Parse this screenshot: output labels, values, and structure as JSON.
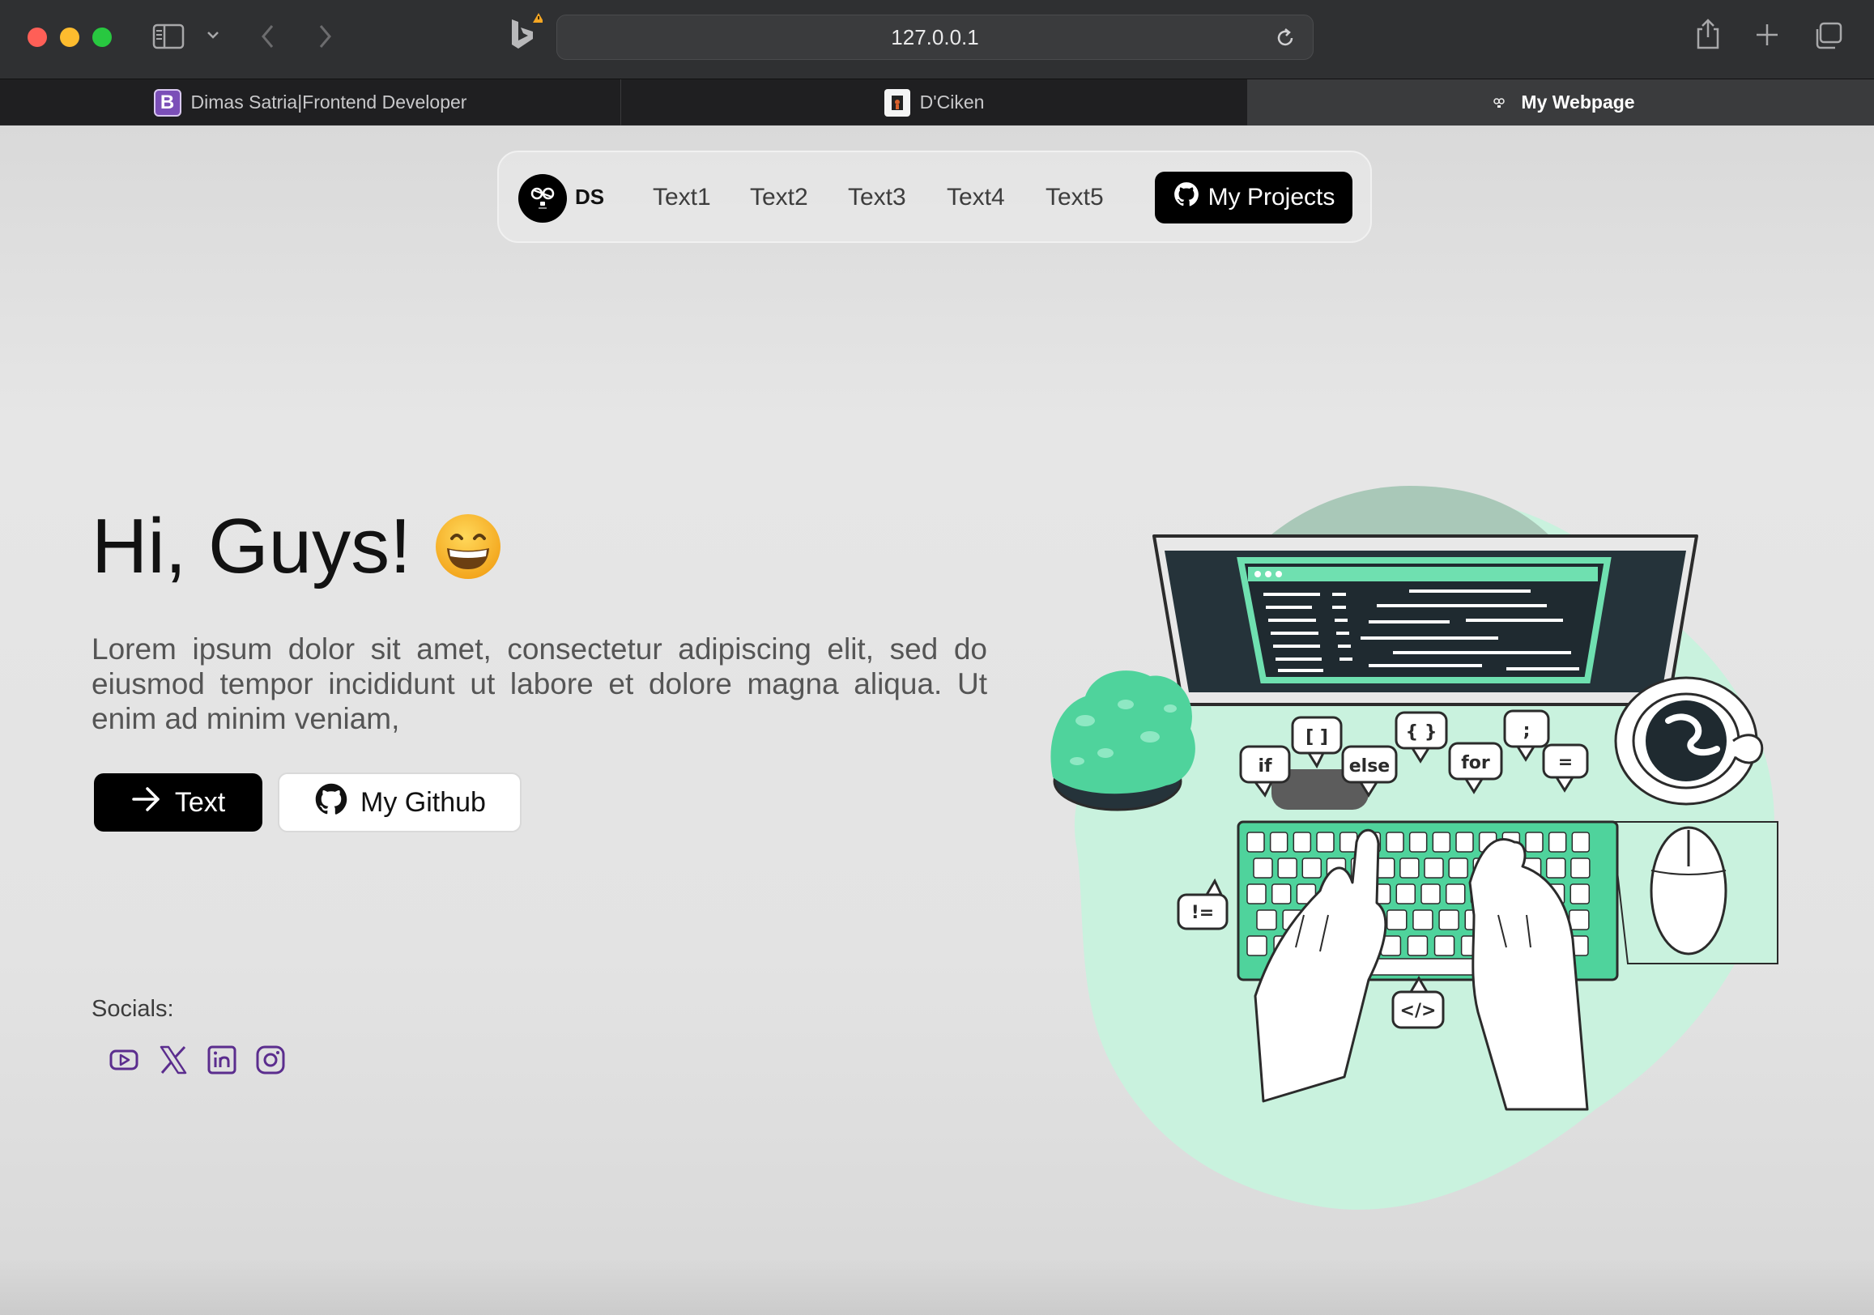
{
  "browser": {
    "url": "127.0.0.1",
    "tabs": [
      {
        "title": "Dimas Satria|Frontend Developer",
        "favicon": "B",
        "active": false
      },
      {
        "title": "D'Ciken",
        "favicon": "image-icon",
        "active": false
      },
      {
        "title": "My Webpage",
        "favicon": "ds-logo",
        "active": true
      }
    ]
  },
  "nav": {
    "brand": "DS",
    "links": [
      "Text1",
      "Text2",
      "Text3",
      "Text4",
      "Text5"
    ],
    "projects_label": "My Projects"
  },
  "hero": {
    "greeting": "Hi, Guys!",
    "emoji": "grinning-face",
    "description": "Lorem ipsum dolor sit amet, consectetur adipiscing elit, sed do eiusmod tempor incididunt ut labore et dolore magna aliqua. Ut enim ad minim veniam,",
    "primary_button": "Text",
    "github_button": "My Github"
  },
  "socials": {
    "label": "Socials:",
    "icons": [
      "youtube-icon",
      "x-icon",
      "linkedin-icon",
      "instagram-icon"
    ],
    "icon_color": "#5b2d8e"
  },
  "illustration": {
    "code_bubbles": [
      "if",
      "[ ]",
      "else",
      "{ }",
      "for",
      ";",
      "=",
      "!=",
      "</>"
    ]
  },
  "colors": {
    "accent_green": "#6fe0b0",
    "button_dark": "#000000",
    "mac_red": "#ff5f57",
    "mac_yellow": "#febc2e",
    "mac_green": "#28c840"
  }
}
